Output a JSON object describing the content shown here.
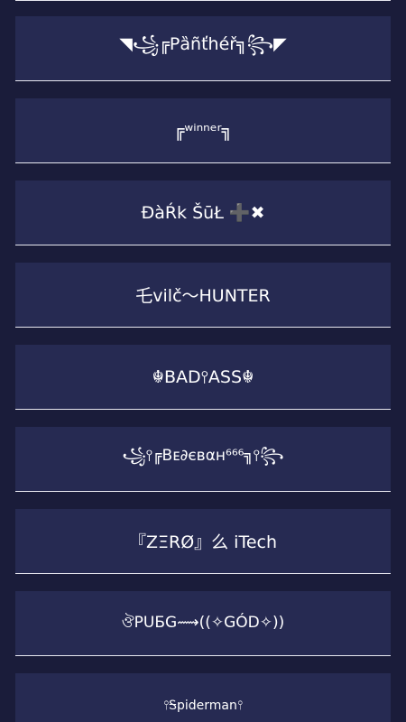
{
  "names": [
    "◥꧁╔Pȁñťhéř╗꧂◤",
    "╔ʷⁱⁿⁿᵉʳ╗",
    "ĐàŔk ŠūŁ ➕✖",
    "乇vilč〜HUNTER",
    "☬BAD⫯ASS☬",
    "꧁⫯╔Bᴇ∂євαн⁶⁶⁶╗⫯꧂",
    "『ZΞRØ』么 iTech",
    "ঔPUБG⟿((✧GÓD✧))",
    "⫯Ꭶpiderman⫯"
  ]
}
